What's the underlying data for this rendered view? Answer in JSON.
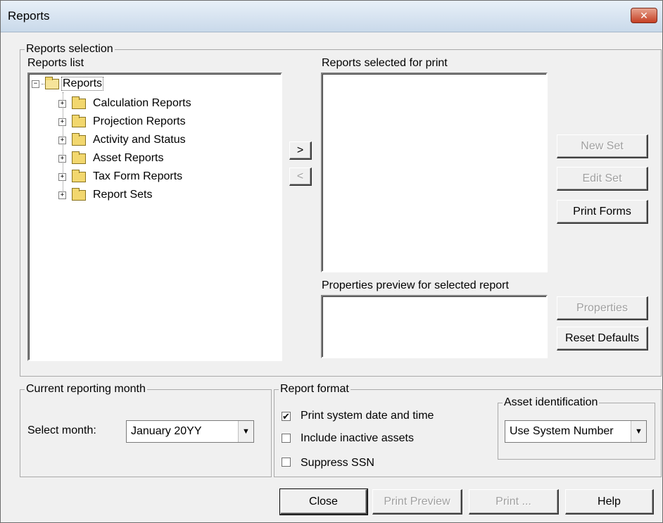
{
  "window": {
    "title": "Reports",
    "close_icon": "close-icon"
  },
  "selection_group": {
    "legend": "Reports selection",
    "reports_list_label": "Reports list",
    "selected_label": "Reports selected for print",
    "preview_label": "Properties preview for selected report",
    "tree": {
      "root": "Reports",
      "children": [
        "Calculation Reports",
        "Projection Reports",
        "Activity and Status",
        "Asset Reports",
        "Tax Form Reports",
        "Report Sets"
      ]
    },
    "add_button": ">",
    "remove_button": "<",
    "buttons": {
      "new_set": "New Set",
      "edit_set": "Edit Set",
      "print_forms": "Print Forms",
      "properties": "Properties",
      "reset_defaults": "Reset Defaults"
    }
  },
  "month_group": {
    "legend": "Current reporting month",
    "select_label": "Select month:",
    "selected_month": "January 20YY"
  },
  "format_group": {
    "legend": "Report format",
    "options": [
      {
        "label": "Print system date and time",
        "checked": true
      },
      {
        "label": "Include inactive assets",
        "checked": false
      },
      {
        "label": "Suppress SSN",
        "checked": false
      }
    ],
    "asset_id": {
      "legend": "Asset identification",
      "selected": "Use System Number"
    }
  },
  "footer": {
    "close": "Close",
    "print_preview": "Print Preview",
    "print": "Print ...",
    "help": "Help"
  }
}
